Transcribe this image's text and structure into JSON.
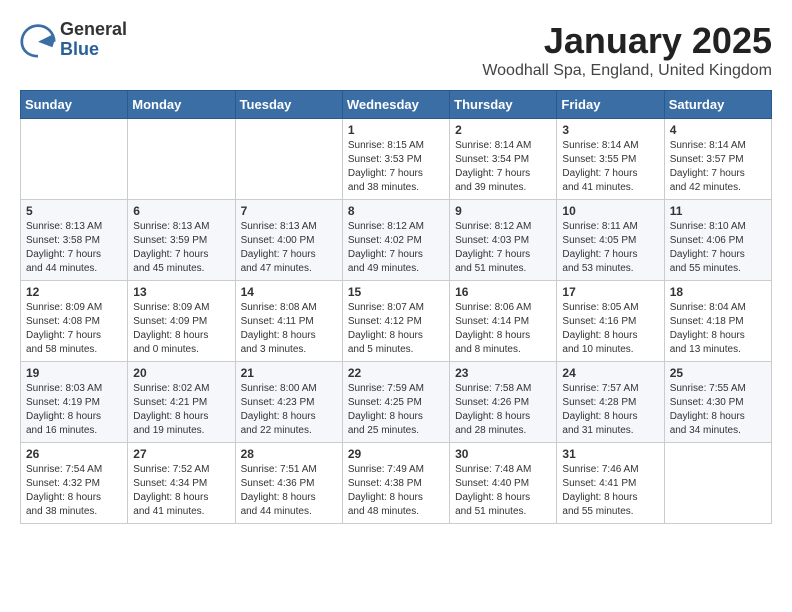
{
  "header": {
    "logo": {
      "general": "General",
      "blue": "Blue"
    },
    "title": "January 2025",
    "location": "Woodhall Spa, England, United Kingdom"
  },
  "weekdays": [
    "Sunday",
    "Monday",
    "Tuesday",
    "Wednesday",
    "Thursday",
    "Friday",
    "Saturday"
  ],
  "weeks": [
    [
      {
        "day": "",
        "info": ""
      },
      {
        "day": "",
        "info": ""
      },
      {
        "day": "",
        "info": ""
      },
      {
        "day": "1",
        "info": "Sunrise: 8:15 AM\nSunset: 3:53 PM\nDaylight: 7 hours\nand 38 minutes."
      },
      {
        "day": "2",
        "info": "Sunrise: 8:14 AM\nSunset: 3:54 PM\nDaylight: 7 hours\nand 39 minutes."
      },
      {
        "day": "3",
        "info": "Sunrise: 8:14 AM\nSunset: 3:55 PM\nDaylight: 7 hours\nand 41 minutes."
      },
      {
        "day": "4",
        "info": "Sunrise: 8:14 AM\nSunset: 3:57 PM\nDaylight: 7 hours\nand 42 minutes."
      }
    ],
    [
      {
        "day": "5",
        "info": "Sunrise: 8:13 AM\nSunset: 3:58 PM\nDaylight: 7 hours\nand 44 minutes."
      },
      {
        "day": "6",
        "info": "Sunrise: 8:13 AM\nSunset: 3:59 PM\nDaylight: 7 hours\nand 45 minutes."
      },
      {
        "day": "7",
        "info": "Sunrise: 8:13 AM\nSunset: 4:00 PM\nDaylight: 7 hours\nand 47 minutes."
      },
      {
        "day": "8",
        "info": "Sunrise: 8:12 AM\nSunset: 4:02 PM\nDaylight: 7 hours\nand 49 minutes."
      },
      {
        "day": "9",
        "info": "Sunrise: 8:12 AM\nSunset: 4:03 PM\nDaylight: 7 hours\nand 51 minutes."
      },
      {
        "day": "10",
        "info": "Sunrise: 8:11 AM\nSunset: 4:05 PM\nDaylight: 7 hours\nand 53 minutes."
      },
      {
        "day": "11",
        "info": "Sunrise: 8:10 AM\nSunset: 4:06 PM\nDaylight: 7 hours\nand 55 minutes."
      }
    ],
    [
      {
        "day": "12",
        "info": "Sunrise: 8:09 AM\nSunset: 4:08 PM\nDaylight: 7 hours\nand 58 minutes."
      },
      {
        "day": "13",
        "info": "Sunrise: 8:09 AM\nSunset: 4:09 PM\nDaylight: 8 hours\nand 0 minutes."
      },
      {
        "day": "14",
        "info": "Sunrise: 8:08 AM\nSunset: 4:11 PM\nDaylight: 8 hours\nand 3 minutes."
      },
      {
        "day": "15",
        "info": "Sunrise: 8:07 AM\nSunset: 4:12 PM\nDaylight: 8 hours\nand 5 minutes."
      },
      {
        "day": "16",
        "info": "Sunrise: 8:06 AM\nSunset: 4:14 PM\nDaylight: 8 hours\nand 8 minutes."
      },
      {
        "day": "17",
        "info": "Sunrise: 8:05 AM\nSunset: 4:16 PM\nDaylight: 8 hours\nand 10 minutes."
      },
      {
        "day": "18",
        "info": "Sunrise: 8:04 AM\nSunset: 4:18 PM\nDaylight: 8 hours\nand 13 minutes."
      }
    ],
    [
      {
        "day": "19",
        "info": "Sunrise: 8:03 AM\nSunset: 4:19 PM\nDaylight: 8 hours\nand 16 minutes."
      },
      {
        "day": "20",
        "info": "Sunrise: 8:02 AM\nSunset: 4:21 PM\nDaylight: 8 hours\nand 19 minutes."
      },
      {
        "day": "21",
        "info": "Sunrise: 8:00 AM\nSunset: 4:23 PM\nDaylight: 8 hours\nand 22 minutes."
      },
      {
        "day": "22",
        "info": "Sunrise: 7:59 AM\nSunset: 4:25 PM\nDaylight: 8 hours\nand 25 minutes."
      },
      {
        "day": "23",
        "info": "Sunrise: 7:58 AM\nSunset: 4:26 PM\nDaylight: 8 hours\nand 28 minutes."
      },
      {
        "day": "24",
        "info": "Sunrise: 7:57 AM\nSunset: 4:28 PM\nDaylight: 8 hours\nand 31 minutes."
      },
      {
        "day": "25",
        "info": "Sunrise: 7:55 AM\nSunset: 4:30 PM\nDaylight: 8 hours\nand 34 minutes."
      }
    ],
    [
      {
        "day": "26",
        "info": "Sunrise: 7:54 AM\nSunset: 4:32 PM\nDaylight: 8 hours\nand 38 minutes."
      },
      {
        "day": "27",
        "info": "Sunrise: 7:52 AM\nSunset: 4:34 PM\nDaylight: 8 hours\nand 41 minutes."
      },
      {
        "day": "28",
        "info": "Sunrise: 7:51 AM\nSunset: 4:36 PM\nDaylight: 8 hours\nand 44 minutes."
      },
      {
        "day": "29",
        "info": "Sunrise: 7:49 AM\nSunset: 4:38 PM\nDaylight: 8 hours\nand 48 minutes."
      },
      {
        "day": "30",
        "info": "Sunrise: 7:48 AM\nSunset: 4:40 PM\nDaylight: 8 hours\nand 51 minutes."
      },
      {
        "day": "31",
        "info": "Sunrise: 7:46 AM\nSunset: 4:41 PM\nDaylight: 8 hours\nand 55 minutes."
      },
      {
        "day": "",
        "info": ""
      }
    ]
  ]
}
